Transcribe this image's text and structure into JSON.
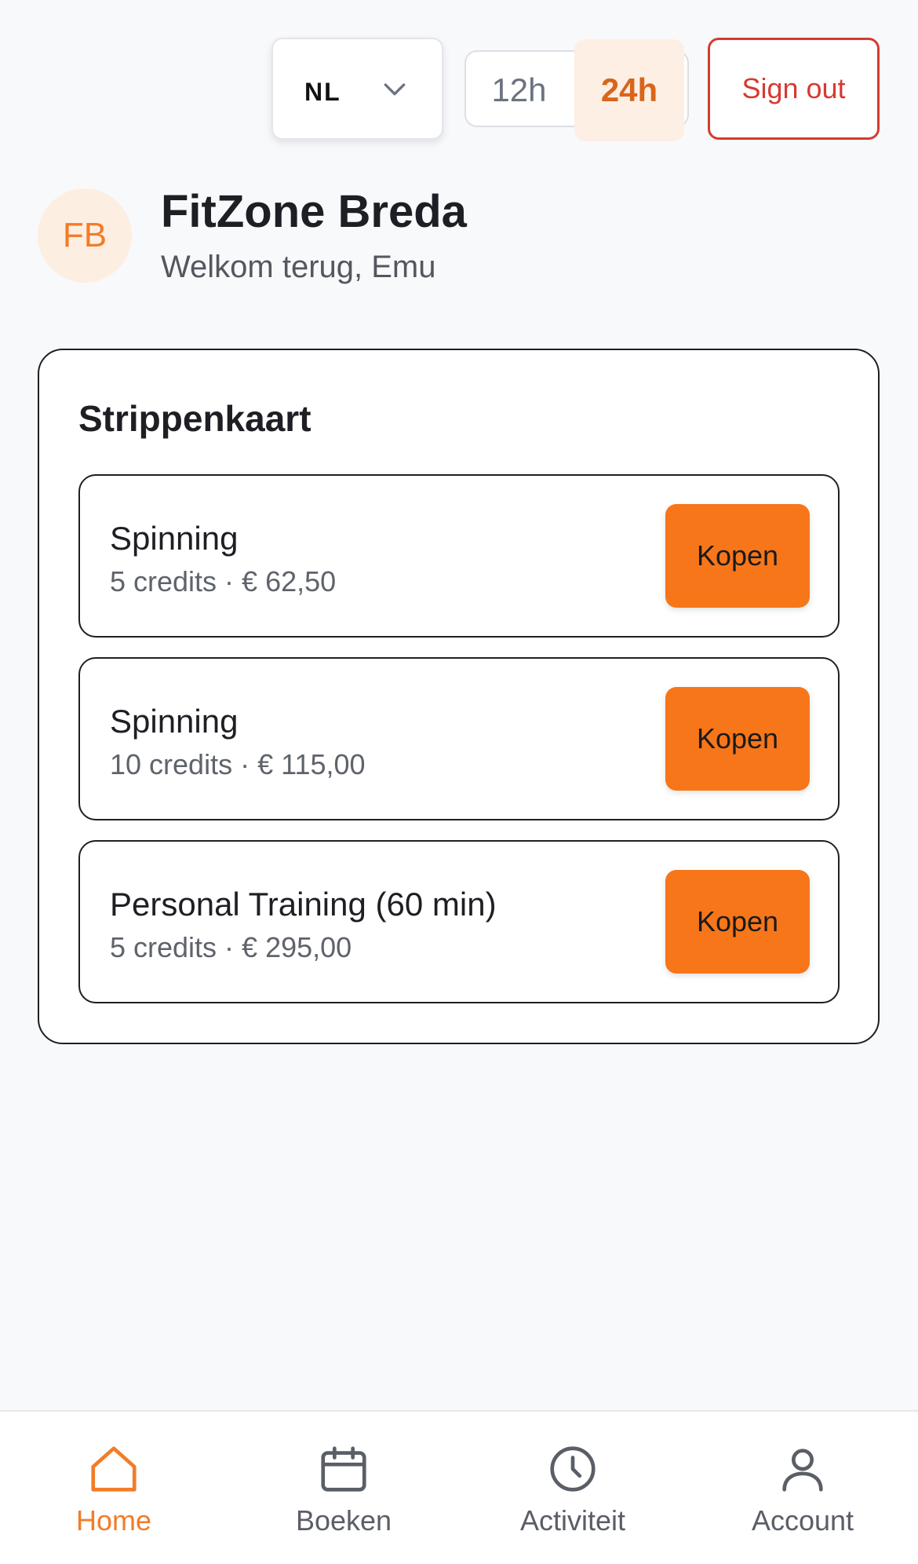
{
  "top_bar": {
    "language": "NL",
    "time_format_options": [
      "12h",
      "24h"
    ],
    "time_format_selected": "24h",
    "sign_out_label": "Sign out"
  },
  "header": {
    "avatar_initials": "FB",
    "studio_name": "FitZone Breda",
    "welcome_text": "Welkom terug, Emu"
  },
  "punch_card": {
    "title": "Strippenkaart",
    "packs": [
      {
        "name": "Spinning",
        "meta": "5 credits · € 62,50",
        "button": "Kopen"
      },
      {
        "name": "Spinning",
        "meta": "10 credits · € 115,00",
        "button": "Kopen"
      },
      {
        "name": "Personal Training (60 min)",
        "meta": "5 credits · € 295,00",
        "button": "Kopen"
      }
    ]
  },
  "bottom_nav": {
    "items": [
      {
        "label": "Home",
        "icon": "home-icon",
        "active": true
      },
      {
        "label": "Boeken",
        "icon": "calendar-icon",
        "active": false
      },
      {
        "label": "Activiteit",
        "icon": "clock-icon",
        "active": false
      },
      {
        "label": "Account",
        "icon": "user-icon",
        "active": false
      }
    ]
  },
  "colors": {
    "accent": "#f7761a",
    "accent_text": "#f27c28",
    "danger": "#d63a31",
    "background": "#f8f9fb"
  }
}
